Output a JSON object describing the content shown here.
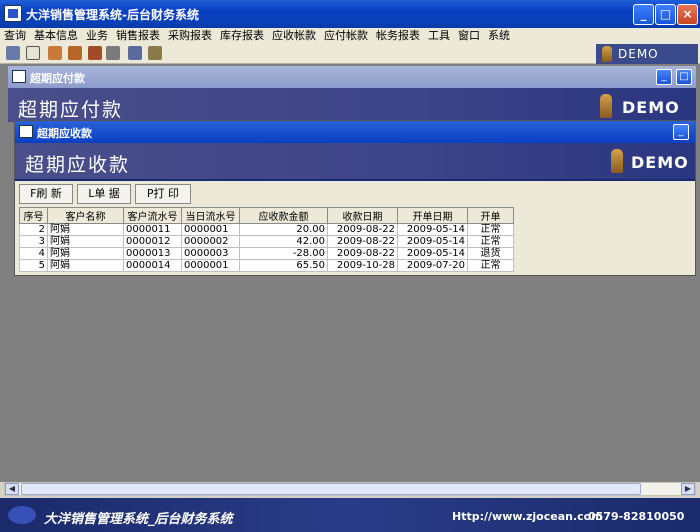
{
  "window": {
    "title": "大洋销售管理系统-后台财务系统",
    "min": "_",
    "max": "□",
    "close": "×"
  },
  "menu": [
    "查询",
    "基本信息",
    "业务",
    "销售报表",
    "采购报表",
    "库存报表",
    "应收帐款",
    "应付帐款",
    "帐务报表",
    "工具",
    "窗口",
    "系统"
  ],
  "toolbar_icons": [
    "printer-icon",
    "document-icon",
    "user-icon",
    "people-icon",
    "users-icon",
    "phone-icon",
    "settings-icon",
    "key-icon"
  ],
  "demo_label": "DEMO",
  "back_window": {
    "title": "超期应付款",
    "heading": "超期应付款",
    "demo": "DEMO"
  },
  "front_window": {
    "title": "超期应收款",
    "heading": "超期应收款",
    "demo": "DEMO",
    "buttons": [
      {
        "name": "refresh-button",
        "label": "F刷 新"
      },
      {
        "name": "voucher-button",
        "label": "L单 据"
      },
      {
        "name": "print-button",
        "label": "P打 印"
      }
    ],
    "table": {
      "headers": [
        "序号",
        "客户名称",
        "客户流水号",
        "当日流水号",
        "应收款金额",
        "收款日期",
        "开单日期",
        "开单"
      ],
      "rows": [
        [
          "2",
          "阿娟",
          "0000011",
          "0000001",
          "20.00",
          "2009-08-22",
          "2009-05-14",
          "正常"
        ],
        [
          "3",
          "阿娟",
          "0000012",
          "0000002",
          "42.00",
          "2009-08-22",
          "2009-05-14",
          "正常"
        ],
        [
          "4",
          "阿娟",
          "0000013",
          "0000003",
          "-28.00",
          "2009-08-22",
          "2009-05-14",
          "退货"
        ],
        [
          "5",
          "阿娟",
          "0000014",
          "0000001",
          "65.50",
          "2009-10-28",
          "2009-07-20",
          "正常"
        ]
      ]
    }
  },
  "statusbar": {
    "name": "大洋销售管理系统_后台财务系统",
    "url": "Http://www.zjocean.com",
    "phone": "0579-82810050"
  }
}
